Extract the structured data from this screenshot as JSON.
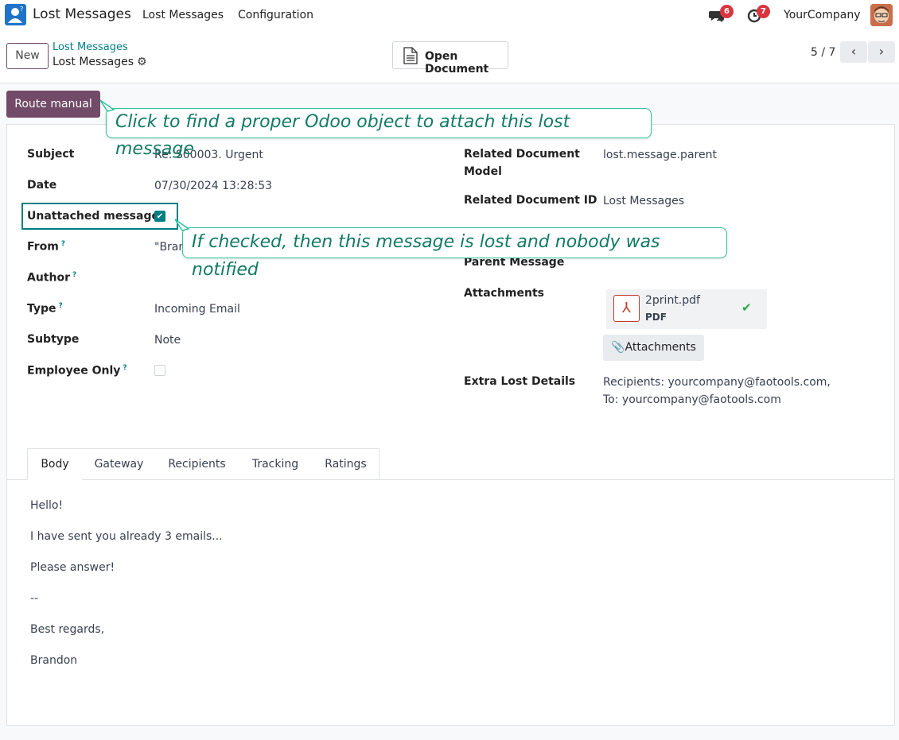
{
  "navbar": {
    "app_title": "Lost Messages",
    "menu": [
      "Lost Messages",
      "Configuration"
    ],
    "chat_badge": "6",
    "activity_badge": "7",
    "company": "YourCompany"
  },
  "control": {
    "new_label": "New",
    "breadcrumb_parent": "Lost Messages",
    "breadcrumb_current": "Lost Messages",
    "open_document_label": "Open Document",
    "pager": "5 / 7"
  },
  "status_bar": {
    "route_manual_label": "Route manual"
  },
  "tooltips": {
    "route": "Click to find a proper Odoo object to attach this lost message",
    "unattached": "If checked, then this message is lost and nobody was notified"
  },
  "form": {
    "left": {
      "subject_label": "Subject",
      "subject_value": "Re: S00003. Urgent",
      "date_label": "Date",
      "date_value": "07/30/2024 13:28:53",
      "unattached_label": "Unattached message",
      "unattached_checked": true,
      "from_label": "From",
      "from_value": "\"Bran",
      "author_label": "Author",
      "type_label": "Type",
      "type_value": "Incoming Email",
      "subtype_label": "Subtype",
      "subtype_value": "Note",
      "employee_only_label": "Employee Only",
      "employee_only_checked": false,
      "help_mark": "?"
    },
    "right": {
      "model_label_1": "Related Document",
      "model_label_2": "Model",
      "model_value": "lost.message.parent",
      "docid_label": "Related Document ID",
      "docid_value": "Lost Messages",
      "parent_label": "Parent Message",
      "attachments_label": "Attachments",
      "attachment_name": "2print.pdf",
      "attachment_type": "PDF",
      "attachments_button": "Attachments",
      "extra_label": "Extra Lost Details",
      "extra_line1": "Recipients: yourcompany@faotools.com,",
      "extra_line2": "To: yourcompany@faotools.com"
    }
  },
  "tabs": [
    "Body",
    "Gateway",
    "Recipients",
    "Tracking",
    "Ratings"
  ],
  "body_lines": [
    "Hello!",
    "I have sent you already 3 emails...",
    "Please answer!",
    "--",
    "Best regards,",
    "Brandon"
  ],
  "colors": {
    "brand": "#714b67",
    "accent": "#017e84",
    "tooltip_border": "#30c2a0",
    "badge": "#d9353f"
  },
  "icons": [
    "app-contact-icon",
    "chat-icon",
    "activity-clock-icon",
    "gear-icon",
    "document-icon",
    "chevron-left-icon",
    "chevron-right-icon",
    "pdf-file-icon",
    "check-icon",
    "paperclip-icon"
  ]
}
